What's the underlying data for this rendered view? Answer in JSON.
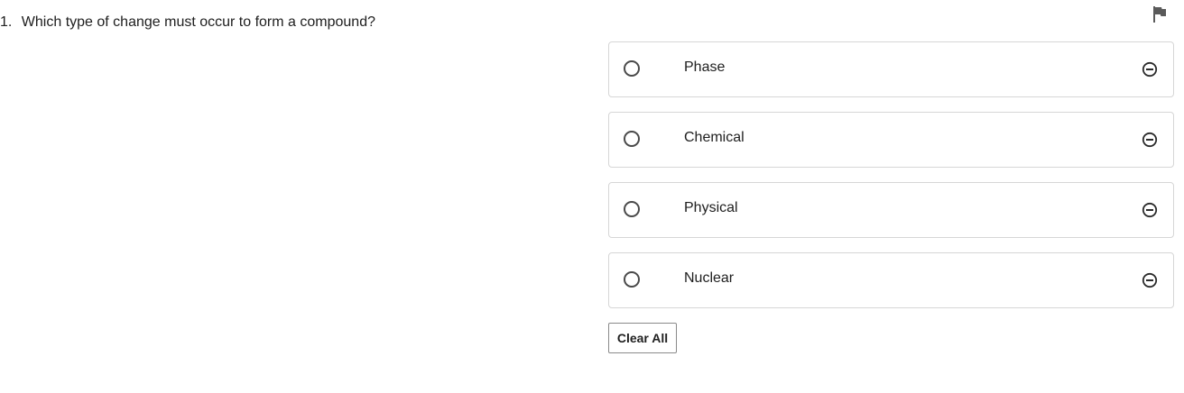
{
  "question": {
    "number": "1.",
    "text": "Which type of change must occur to form a compound?"
  },
  "flag": {
    "icon": "flag-icon"
  },
  "choices": [
    {
      "label": "Phase",
      "selected": false
    },
    {
      "label": "Chemical",
      "selected": false
    },
    {
      "label": "Physical",
      "selected": false
    },
    {
      "label": "Nuclear",
      "selected": false
    }
  ],
  "clear_all_label": "Clear All"
}
